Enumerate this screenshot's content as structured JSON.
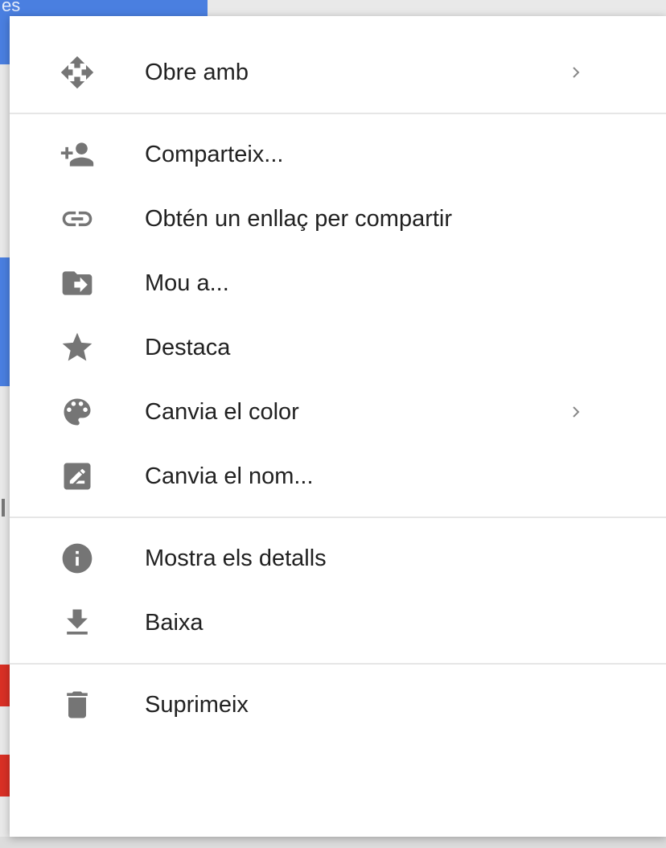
{
  "background": {
    "topbar_text": "es"
  },
  "menu": {
    "items": [
      {
        "label": "Obre amb",
        "icon": "open-with-icon",
        "submenu": true
      },
      {
        "label": "Comparteix...",
        "icon": "add-person-icon",
        "submenu": false
      },
      {
        "label": "Obtén un enllaç per compartir",
        "icon": "link-icon",
        "submenu": false
      },
      {
        "label": "Mou a...",
        "icon": "move-to-folder-icon",
        "submenu": false
      },
      {
        "label": "Destaca",
        "icon": "star-icon",
        "submenu": false
      },
      {
        "label": "Canvia el color",
        "icon": "palette-icon",
        "submenu": true
      },
      {
        "label": "Canvia el nom...",
        "icon": "rename-icon",
        "submenu": false
      },
      {
        "label": "Mostra els detalls",
        "icon": "info-icon",
        "submenu": false
      },
      {
        "label": "Baixa",
        "icon": "download-icon",
        "submenu": false
      },
      {
        "label": "Suprimeix",
        "icon": "trash-icon",
        "submenu": false
      }
    ]
  },
  "colors": {
    "icon": "#757575",
    "text": "#212121",
    "divider": "#e6e6e6",
    "accent_blue": "#4a7fe0",
    "accent_red": "#d93025"
  }
}
